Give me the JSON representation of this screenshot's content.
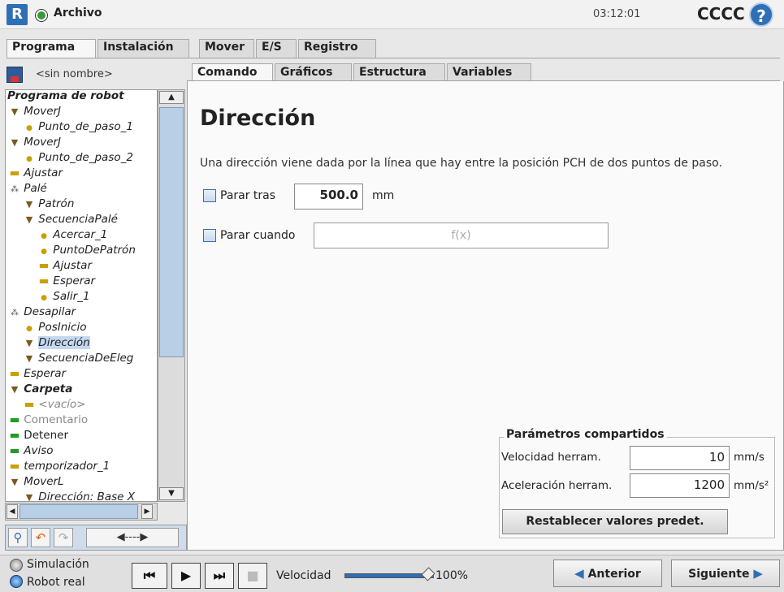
{
  "header": {
    "file_title": "Archivo",
    "clock": "03:12:01",
    "robot_name": "CCCC",
    "help_icon": "?"
  },
  "main_tabs": [
    {
      "label": "Programa",
      "active": true
    },
    {
      "label": "Instalación",
      "active": false
    },
    {
      "label": "Mover",
      "active": false
    },
    {
      "label": "E/S",
      "active": false
    },
    {
      "label": "Registro",
      "active": false
    }
  ],
  "program": {
    "name": "<sin nombre>",
    "tree_root": "Programa de robot",
    "tree": [
      {
        "label": "MoverJ",
        "icon": "triangle",
        "indent": 0
      },
      {
        "label": "Punto_de_paso_1",
        "icon": "dot",
        "indent": 1
      },
      {
        "label": "MoverJ",
        "icon": "triangle",
        "indent": 0
      },
      {
        "label": "Punto_de_paso_2",
        "icon": "dot",
        "indent": 1
      },
      {
        "label": "Ajustar",
        "icon": "bar",
        "indent": 0
      },
      {
        "label": "Palé",
        "icon": "pallet",
        "indent": 0
      },
      {
        "label": "Patrón",
        "icon": "triangle",
        "indent": 1
      },
      {
        "label": "SecuenciaPalé",
        "icon": "triangle",
        "indent": 1
      },
      {
        "label": "Acercar_1",
        "icon": "dot",
        "indent": 2
      },
      {
        "label": "PuntoDePatrón",
        "icon": "dot",
        "indent": 2
      },
      {
        "label": "Ajustar",
        "icon": "bar",
        "indent": 2
      },
      {
        "label": "Esperar",
        "icon": "bar",
        "indent": 2
      },
      {
        "label": "Salir_1",
        "icon": "dot",
        "indent": 2
      },
      {
        "label": "Desapilar",
        "icon": "pallet",
        "indent": 0
      },
      {
        "label": "PosInicio",
        "icon": "dot",
        "indent": 1
      },
      {
        "label": "Dirección",
        "icon": "triangle",
        "indent": 1,
        "selected": true
      },
      {
        "label": "SecuenciaDeEleg",
        "icon": "triangle",
        "indent": 1
      },
      {
        "label": "Esperar",
        "icon": "bar",
        "indent": 0
      },
      {
        "label": "Carpeta",
        "icon": "triangle",
        "indent": 0,
        "bold": true
      },
      {
        "label": "<vacío>",
        "icon": "bar",
        "indent": 1,
        "muted": true
      },
      {
        "label": "Comentario",
        "icon": "green",
        "indent": 0,
        "muted": true,
        "upright": true
      },
      {
        "label": "Detener",
        "icon": "green",
        "indent": 0,
        "upright": true
      },
      {
        "label": "Aviso",
        "icon": "green",
        "indent": 0
      },
      {
        "label": "temporizador_1",
        "icon": "bar",
        "indent": 0
      },
      {
        "label": "MoverL",
        "icon": "triangle",
        "indent": 0
      },
      {
        "label": "Dirección: Base X",
        "icon": "triangle",
        "indent": 1
      }
    ],
    "tools_move_label": "◀----▶"
  },
  "sub_tabs": [
    {
      "label": "Comando",
      "active": true
    },
    {
      "label": "Gráficos",
      "active": false
    },
    {
      "label": "Estructura",
      "active": false
    },
    {
      "label": "Variables",
      "active": false
    }
  ],
  "command": {
    "title": "Dirección",
    "description": "Una dirección viene dada por la línea que hay entre la posición PCH de dos puntos de paso.",
    "stop_after_label": "Parar tras",
    "stop_after_value": "500.0",
    "stop_after_unit": "mm",
    "stop_when_label": "Parar cuando",
    "stop_when_placeholder": "f(x)"
  },
  "shared_params": {
    "title": "Parámetros compartidos",
    "speed_label": "Velocidad herram.",
    "speed_value": "10",
    "speed_unit": "mm/s",
    "accel_label": "Aceleración herram.",
    "accel_value": "1200",
    "accel_unit": "mm/s²",
    "reset_label": "Restablecer valores predet."
  },
  "footer": {
    "sim_label": "Simulación",
    "real_label": "Robot real",
    "speed_label": "Velocidad",
    "speed_pct": "100%",
    "prev_label": "Anterior",
    "next_label": "Siguiente"
  }
}
